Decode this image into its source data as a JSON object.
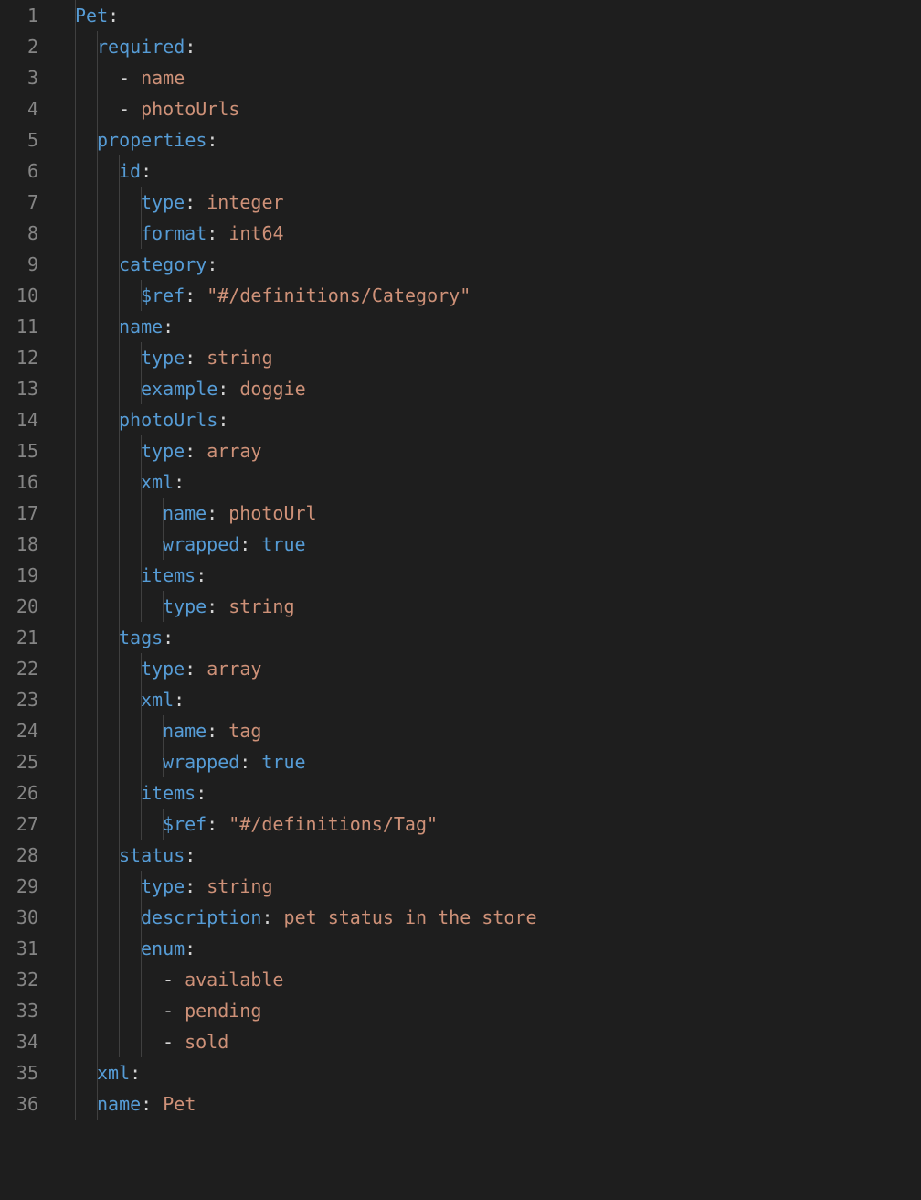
{
  "totalLines": 36,
  "lines": [
    {
      "indent": 1,
      "guides": [
        0
      ],
      "tokens": [
        {
          "t": "Pet",
          "c": "key"
        },
        {
          "t": ":",
          "c": "punc"
        }
      ]
    },
    {
      "indent": 2,
      "guides": [
        0,
        1
      ],
      "tokens": [
        {
          "t": "required",
          "c": "key"
        },
        {
          "t": ":",
          "c": "punc"
        }
      ]
    },
    {
      "indent": 3,
      "guides": [
        0,
        1
      ],
      "tokens": [
        {
          "t": "-",
          "c": "dash"
        },
        {
          "t": " ",
          "c": "punc"
        },
        {
          "t": "name",
          "c": "str"
        }
      ]
    },
    {
      "indent": 3,
      "guides": [
        0,
        1
      ],
      "tokens": [
        {
          "t": "-",
          "c": "dash"
        },
        {
          "t": " ",
          "c": "punc"
        },
        {
          "t": "photoUrls",
          "c": "str"
        }
      ]
    },
    {
      "indent": 2,
      "guides": [
        0,
        1
      ],
      "tokens": [
        {
          "t": "properties",
          "c": "key"
        },
        {
          "t": ":",
          "c": "punc"
        }
      ]
    },
    {
      "indent": 3,
      "guides": [
        0,
        1,
        2
      ],
      "tokens": [
        {
          "t": "id",
          "c": "key"
        },
        {
          "t": ":",
          "c": "punc"
        }
      ]
    },
    {
      "indent": 4,
      "guides": [
        0,
        1,
        2,
        3
      ],
      "tokens": [
        {
          "t": "type",
          "c": "key"
        },
        {
          "t": ":",
          "c": "punc"
        },
        {
          "t": " ",
          "c": "punc"
        },
        {
          "t": "integer",
          "c": "str"
        }
      ]
    },
    {
      "indent": 4,
      "guides": [
        0,
        1,
        2,
        3
      ],
      "tokens": [
        {
          "t": "format",
          "c": "key"
        },
        {
          "t": ":",
          "c": "punc"
        },
        {
          "t": " ",
          "c": "punc"
        },
        {
          "t": "int64",
          "c": "str"
        }
      ]
    },
    {
      "indent": 3,
      "guides": [
        0,
        1,
        2
      ],
      "tokens": [
        {
          "t": "category",
          "c": "key"
        },
        {
          "t": ":",
          "c": "punc"
        }
      ]
    },
    {
      "indent": 4,
      "guides": [
        0,
        1,
        2,
        3
      ],
      "tokens": [
        {
          "t": "$ref",
          "c": "key"
        },
        {
          "t": ":",
          "c": "punc"
        },
        {
          "t": " ",
          "c": "punc"
        },
        {
          "t": "\"#/definitions/Category\"",
          "c": "str"
        }
      ]
    },
    {
      "indent": 3,
      "guides": [
        0,
        1,
        2
      ],
      "tokens": [
        {
          "t": "name",
          "c": "key"
        },
        {
          "t": ":",
          "c": "punc"
        }
      ]
    },
    {
      "indent": 4,
      "guides": [
        0,
        1,
        2,
        3
      ],
      "tokens": [
        {
          "t": "type",
          "c": "key"
        },
        {
          "t": ":",
          "c": "punc"
        },
        {
          "t": " ",
          "c": "punc"
        },
        {
          "t": "string",
          "c": "str"
        }
      ]
    },
    {
      "indent": 4,
      "guides": [
        0,
        1,
        2,
        3
      ],
      "tokens": [
        {
          "t": "example",
          "c": "key"
        },
        {
          "t": ":",
          "c": "punc"
        },
        {
          "t": " ",
          "c": "punc"
        },
        {
          "t": "doggie",
          "c": "str"
        }
      ]
    },
    {
      "indent": 3,
      "guides": [
        0,
        1,
        2
      ],
      "tokens": [
        {
          "t": "photoUrls",
          "c": "key"
        },
        {
          "t": ":",
          "c": "punc"
        }
      ]
    },
    {
      "indent": 4,
      "guides": [
        0,
        1,
        2,
        3
      ],
      "tokens": [
        {
          "t": "type",
          "c": "key"
        },
        {
          "t": ":",
          "c": "punc"
        },
        {
          "t": " ",
          "c": "punc"
        },
        {
          "t": "array",
          "c": "str"
        }
      ]
    },
    {
      "indent": 4,
      "guides": [
        0,
        1,
        2,
        3
      ],
      "tokens": [
        {
          "t": "xml",
          "c": "key"
        },
        {
          "t": ":",
          "c": "punc"
        }
      ]
    },
    {
      "indent": 5,
      "guides": [
        0,
        1,
        2,
        3,
        4
      ],
      "tokens": [
        {
          "t": "name",
          "c": "key"
        },
        {
          "t": ":",
          "c": "punc"
        },
        {
          "t": " ",
          "c": "punc"
        },
        {
          "t": "photoUrl",
          "c": "str"
        }
      ]
    },
    {
      "indent": 5,
      "guides": [
        0,
        1,
        2,
        3,
        4
      ],
      "tokens": [
        {
          "t": "wrapped",
          "c": "key"
        },
        {
          "t": ":",
          "c": "punc"
        },
        {
          "t": " ",
          "c": "punc"
        },
        {
          "t": "true",
          "c": "bool"
        }
      ]
    },
    {
      "indent": 4,
      "guides": [
        0,
        1,
        2,
        3
      ],
      "tokens": [
        {
          "t": "items",
          "c": "key"
        },
        {
          "t": ":",
          "c": "punc"
        }
      ]
    },
    {
      "indent": 5,
      "guides": [
        0,
        1,
        2,
        3,
        4
      ],
      "tokens": [
        {
          "t": "type",
          "c": "key"
        },
        {
          "t": ":",
          "c": "punc"
        },
        {
          "t": " ",
          "c": "punc"
        },
        {
          "t": "string",
          "c": "str"
        }
      ]
    },
    {
      "indent": 3,
      "guides": [
        0,
        1,
        2
      ],
      "tokens": [
        {
          "t": "tags",
          "c": "key"
        },
        {
          "t": ":",
          "c": "punc"
        }
      ]
    },
    {
      "indent": 4,
      "guides": [
        0,
        1,
        2,
        3
      ],
      "tokens": [
        {
          "t": "type",
          "c": "key"
        },
        {
          "t": ":",
          "c": "punc"
        },
        {
          "t": " ",
          "c": "punc"
        },
        {
          "t": "array",
          "c": "str"
        }
      ]
    },
    {
      "indent": 4,
      "guides": [
        0,
        1,
        2,
        3
      ],
      "tokens": [
        {
          "t": "xml",
          "c": "key"
        },
        {
          "t": ":",
          "c": "punc"
        }
      ]
    },
    {
      "indent": 5,
      "guides": [
        0,
        1,
        2,
        3,
        4
      ],
      "tokens": [
        {
          "t": "name",
          "c": "key"
        },
        {
          "t": ":",
          "c": "punc"
        },
        {
          "t": " ",
          "c": "punc"
        },
        {
          "t": "tag",
          "c": "str"
        }
      ]
    },
    {
      "indent": 5,
      "guides": [
        0,
        1,
        2,
        3,
        4
      ],
      "tokens": [
        {
          "t": "wrapped",
          "c": "key"
        },
        {
          "t": ":",
          "c": "punc"
        },
        {
          "t": " ",
          "c": "punc"
        },
        {
          "t": "true",
          "c": "bool"
        }
      ]
    },
    {
      "indent": 4,
      "guides": [
        0,
        1,
        2,
        3
      ],
      "tokens": [
        {
          "t": "items",
          "c": "key"
        },
        {
          "t": ":",
          "c": "punc"
        }
      ]
    },
    {
      "indent": 5,
      "guides": [
        0,
        1,
        2,
        3,
        4
      ],
      "tokens": [
        {
          "t": "$ref",
          "c": "key"
        },
        {
          "t": ":",
          "c": "punc"
        },
        {
          "t": " ",
          "c": "punc"
        },
        {
          "t": "\"#/definitions/Tag\"",
          "c": "str"
        }
      ]
    },
    {
      "indent": 3,
      "guides": [
        0,
        1,
        2
      ],
      "tokens": [
        {
          "t": "status",
          "c": "key"
        },
        {
          "t": ":",
          "c": "punc"
        }
      ]
    },
    {
      "indent": 4,
      "guides": [
        0,
        1,
        2,
        3
      ],
      "tokens": [
        {
          "t": "type",
          "c": "key"
        },
        {
          "t": ":",
          "c": "punc"
        },
        {
          "t": " ",
          "c": "punc"
        },
        {
          "t": "string",
          "c": "str"
        }
      ]
    },
    {
      "indent": 4,
      "guides": [
        0,
        1,
        2,
        3
      ],
      "tokens": [
        {
          "t": "description",
          "c": "key"
        },
        {
          "t": ":",
          "c": "punc"
        },
        {
          "t": " ",
          "c": "punc"
        },
        {
          "t": "pet status in the store",
          "c": "str"
        }
      ]
    },
    {
      "indent": 4,
      "guides": [
        0,
        1,
        2,
        3
      ],
      "tokens": [
        {
          "t": "enum",
          "c": "key"
        },
        {
          "t": ":",
          "c": "punc"
        }
      ]
    },
    {
      "indent": 5,
      "guides": [
        0,
        1,
        2,
        3
      ],
      "tokens": [
        {
          "t": "-",
          "c": "dash"
        },
        {
          "t": " ",
          "c": "punc"
        },
        {
          "t": "available",
          "c": "str"
        }
      ]
    },
    {
      "indent": 5,
      "guides": [
        0,
        1,
        2,
        3
      ],
      "tokens": [
        {
          "t": "-",
          "c": "dash"
        },
        {
          "t": " ",
          "c": "punc"
        },
        {
          "t": "pending",
          "c": "str"
        }
      ]
    },
    {
      "indent": 5,
      "guides": [
        0,
        1,
        2,
        3
      ],
      "tokens": [
        {
          "t": "-",
          "c": "dash"
        },
        {
          "t": " ",
          "c": "punc"
        },
        {
          "t": "sold",
          "c": "str"
        }
      ]
    },
    {
      "indent": 2,
      "guides": [
        0,
        1
      ],
      "tokens": [
        {
          "t": "xml",
          "c": "key"
        },
        {
          "t": ":",
          "c": "punc"
        }
      ]
    },
    {
      "indent": 2,
      "guides": [
        0,
        1
      ],
      "tokens": [
        {
          "t": "name",
          "c": "key"
        },
        {
          "t": ":",
          "c": "punc"
        },
        {
          "t": " ",
          "c": "punc"
        },
        {
          "t": "Pet",
          "c": "str"
        }
      ]
    }
  ],
  "indentUnit": "  ",
  "indentPx": 24
}
